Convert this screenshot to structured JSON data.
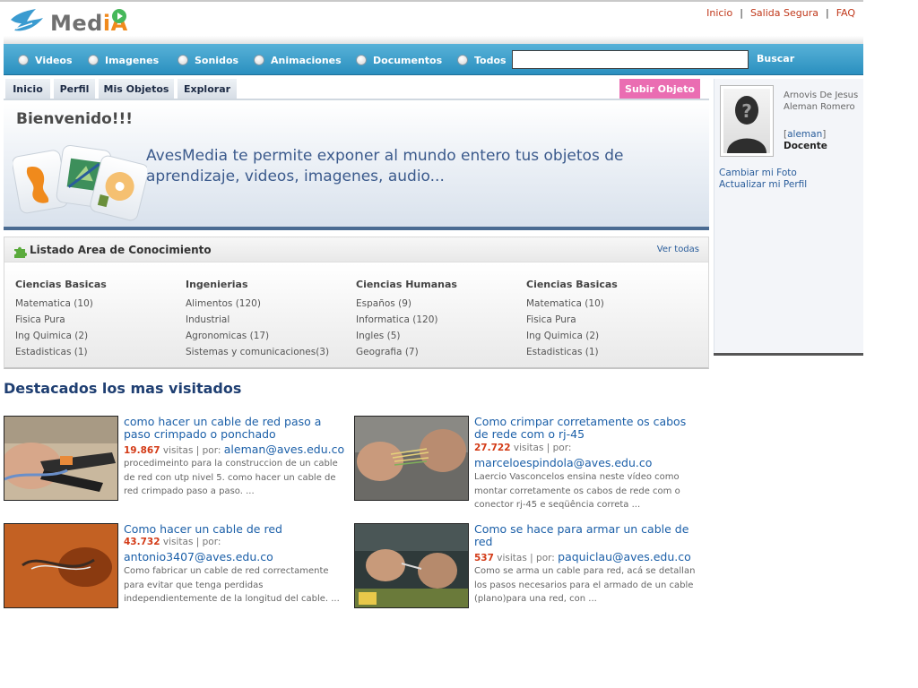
{
  "header": {
    "logo_text_main": "Med",
    "logo_text_accent": "iA",
    "links": [
      "Inicio",
      "Salida Segura",
      "FAQ"
    ],
    "colors": {
      "link": "#c0381b",
      "bar": "#2a8fbf",
      "logo_accent": "#f08a1c"
    }
  },
  "search": {
    "options": [
      "Videos",
      "Imagenes",
      "Sonidos",
      "Animaciones",
      "Documentos",
      "Todos"
    ],
    "input_value": "",
    "button_label": "Buscar"
  },
  "tabs": [
    "Inicio",
    "Perfil",
    "Mis Objetos",
    "Explorar"
  ],
  "upload_button": "Subir Objeto",
  "welcome": {
    "title": "Bienvenido!!!",
    "text": "AvesMedia te permite exponer al mundo entero tus objetos de aprendizaje, videos, imagenes, audio..."
  },
  "areas": {
    "title": "Listado Area de Conocimiento",
    "see_all": "Ver todas",
    "columns": [
      {
        "title": "Ciencias Basicas",
        "items": [
          "Matematica (10)",
          "Fisica Pura",
          "Ing Quimica (2)",
          "Estadisticas (1)"
        ]
      },
      {
        "title": "Ingenierias",
        "items": [
          "Alimentos (120)",
          "Industrial",
          "Agronomicas (17)",
          "Sistemas y comunicaciones(3)"
        ]
      },
      {
        "title": "Ciencias Humanas",
        "items": [
          "Españos (9)",
          "Informatica (120)",
          "Ingles (5)",
          "Geografia (7)"
        ]
      },
      {
        "title": "Ciencias Basicas",
        "items": [
          "Matematica (10)",
          "Fisica Pura",
          "Ing Quimica (2)",
          "Estadisticas (1)"
        ]
      }
    ]
  },
  "featured": {
    "title": "Destacados los mas visitados",
    "visits_label": "visitas",
    "by_label": "por:",
    "items": [
      {
        "title": "como hacer un cable de red paso a paso crimpado o ponchado",
        "visits": "19.867",
        "user": "aleman@aves.edu.co",
        "desc": "procedimeinto para la construccion de un cable de red con utp nivel 5. como hacer un cable de red crimpado paso a paso. ..."
      },
      {
        "title": "Como crimpar corretamente os cabos de rede com o rj-45",
        "visits": "27.722",
        "user": "marceloespindola@aves.edu.co",
        "desc": "Laercio Vasconcelos ensina neste vídeo como montar corretamente os cabos de rede com o conector rj-45 e seqüência correta ..."
      },
      {
        "title": "Como hacer un cable de red",
        "visits": "43.732",
        "user": "antonio3407@aves.edu.co",
        "desc": "Como fabricar un cable de red correctamente para evitar que tenga perdidas independientemente de la longitud del cable. ..."
      },
      {
        "title": "Como se hace para armar un cable de red",
        "visits": "537",
        "user": "paquiclau@aves.edu.co",
        "desc": "Como se arma un cable para red, acá se detallan los pasos necesarios para el armado de un cable (plano)para una red, con ..."
      }
    ]
  },
  "sidebar": {
    "name": "Arnovis De Jesus Aleman Romero",
    "username": "aleman",
    "role": "Docente",
    "links": [
      "Cambiar mi Foto",
      "Actualizar mi Perfil"
    ]
  }
}
